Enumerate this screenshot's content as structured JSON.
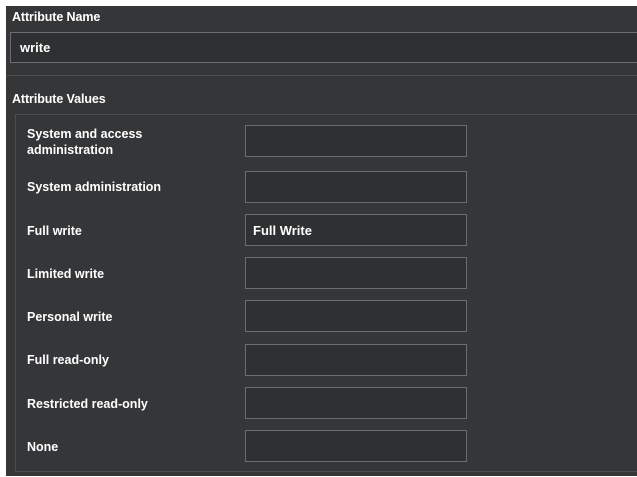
{
  "attribute_name": {
    "title": "Attribute Name",
    "value": "write"
  },
  "attribute_values": {
    "title": "Attribute Values",
    "rows": [
      {
        "label": "System and access administration",
        "value": ""
      },
      {
        "label": "System administration",
        "value": ""
      },
      {
        "label": "Full write",
        "value": "Full Write"
      },
      {
        "label": "Limited write",
        "value": ""
      },
      {
        "label": "Personal write",
        "value": ""
      },
      {
        "label": "Full read-only",
        "value": ""
      },
      {
        "label": "Restricted read-only",
        "value": ""
      },
      {
        "label": "None",
        "value": ""
      }
    ]
  }
}
